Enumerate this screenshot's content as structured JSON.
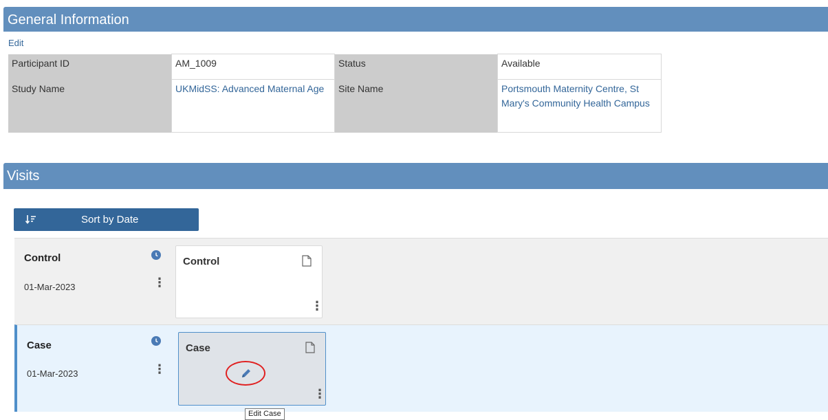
{
  "general_info": {
    "title": "General Information",
    "edit_label": "Edit",
    "fields": {
      "participant_id_label": "Participant ID",
      "participant_id_value": "AM_1009",
      "status_label": "Status",
      "status_value": "Available",
      "study_name_label": "Study Name",
      "study_name_value": "UKMidSS: Advanced Maternal Age",
      "site_name_label": "Site Name",
      "site_name_value": "Portsmouth Maternity Centre, St Mary's Community Health Campus"
    }
  },
  "visits": {
    "title": "Visits",
    "sort_label": "Sort by Date",
    "sort_icon": "sort-descending-icon",
    "rows": [
      {
        "name": "Control",
        "date": "01-Mar-2023",
        "card_title": "Control",
        "selected": false
      },
      {
        "name": "Case",
        "date": "01-Mar-2023",
        "card_title": "Case",
        "selected": true
      }
    ],
    "tooltip": "Edit Case"
  },
  "colors": {
    "header_bg": "#628fbd",
    "button_bg": "#336699",
    "link": "#336699",
    "selected_row_bg": "#e8f3fd",
    "highlight_circle": "#e02020"
  }
}
